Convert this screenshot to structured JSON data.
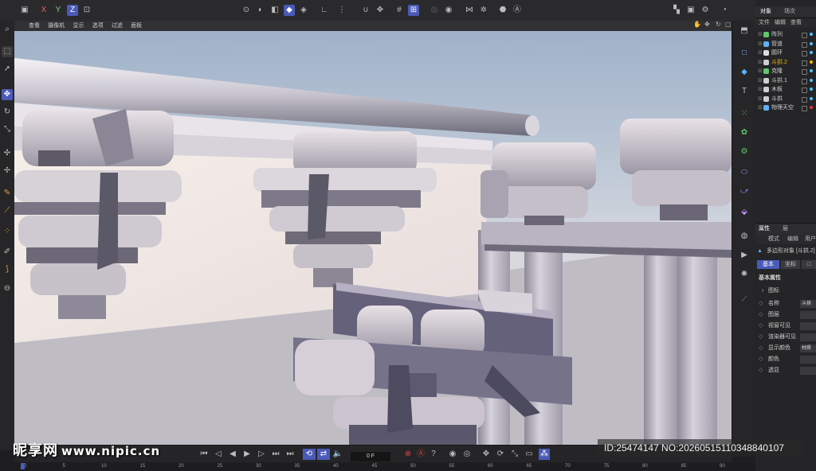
{
  "viewport_menu": [
    "查看",
    "摄像机",
    "显示",
    "选项",
    "过滤",
    "面板"
  ],
  "top_axes": [
    "X",
    "Y",
    "Z"
  ],
  "object_panel": {
    "tabs": [
      "对象",
      "场次"
    ],
    "menu": [
      "文件",
      "编辑",
      "查看"
    ],
    "objects": [
      {
        "name": "阵列",
        "color": "#5fc86a",
        "tag": "#4ec1ff"
      },
      {
        "name": "管道",
        "color": "#5fb0ff",
        "tag": "#4ec1ff"
      },
      {
        "name": "圆环",
        "color": "#dddddd",
        "tag": "#4ec1ff"
      },
      {
        "name": "斗拱.2",
        "color": "#cfcfcf",
        "tag": "#ffb400",
        "highlight": "#f0b400"
      },
      {
        "name": "克隆",
        "color": "#5fc86a",
        "tag": "#4ec1ff"
      },
      {
        "name": "斗拱.1",
        "color": "#cfcfcf",
        "tag": "#4ec1ff"
      },
      {
        "name": "木板",
        "color": "#cfcfcf",
        "tag": "#4ec1ff"
      },
      {
        "name": "斗拱",
        "color": "#cfcfcf",
        "tag": "#4ec1ff"
      },
      {
        "name": "物理天空",
        "color": "#5fb0ff",
        "tag": "#e03a3a"
      }
    ]
  },
  "attr_panel": {
    "tabs": [
      "属性",
      "层"
    ],
    "menu": [
      "模式",
      "编辑",
      "用户"
    ],
    "object_label": "多边形对象 [斗拱.2]",
    "subtabs": [
      "基本",
      "坐标",
      "□"
    ],
    "section": "基本属性",
    "subsection": "图标",
    "props": [
      {
        "label": "名称",
        "value": "斗拱"
      },
      {
        "label": "图层",
        "value": ""
      },
      {
        "label": "视窗可见",
        "value": ""
      },
      {
        "label": "渲染器可见",
        "value": ""
      },
      {
        "label": "显示颜色",
        "value": "材质"
      },
      {
        "label": "颜色",
        "value": ""
      },
      {
        "label": "透显",
        "value": ""
      }
    ]
  },
  "timeline": {
    "frame": "0 F",
    "ruler": [
      "0",
      "5",
      "10",
      "15",
      "20",
      "25",
      "30",
      "35",
      "40",
      "45",
      "50",
      "55",
      "60",
      "65",
      "70",
      "75",
      "80",
      "85",
      "90"
    ]
  },
  "watermark": {
    "site": "昵享网",
    "url": "www.nipic.cn",
    "id": "ID:25474147 NO:20260515110348840107"
  },
  "colors": {
    "accent": "#4a5ab8",
    "highlight": "#f0b400"
  }
}
